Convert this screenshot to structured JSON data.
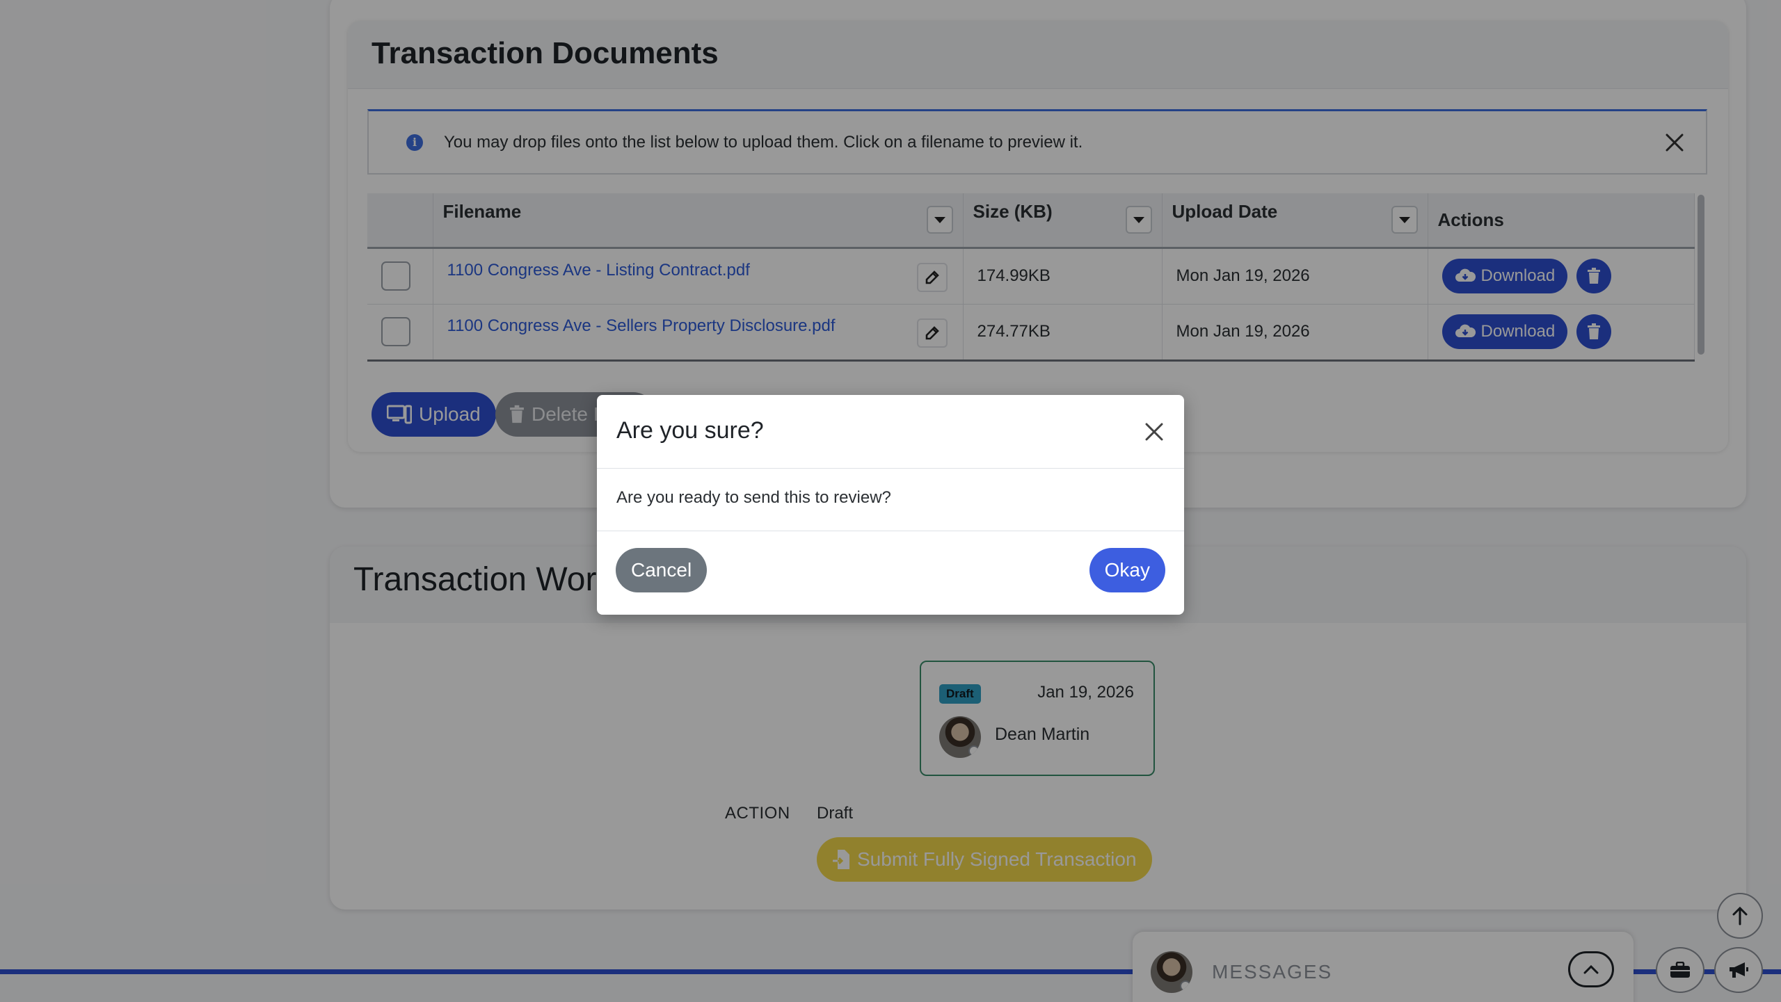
{
  "documents": {
    "title": "Transaction Documents",
    "info_text": "You may drop files onto the list below to upload them. Click on a filename to preview it.",
    "columns": {
      "filename": "Filename",
      "size": "Size (KB)",
      "upload_date": "Upload Date",
      "actions": "Actions"
    },
    "rows": [
      {
        "filename": "1100 Congress Ave - Listing Contract.pdf",
        "size": "174.99KB",
        "upload_date": "Mon Jan 19, 2026",
        "download_label": "Download"
      },
      {
        "filename": "1100 Congress Ave - Sellers Property Disclosure.pdf",
        "size": "274.77KB",
        "upload_date": "Mon Jan 19, 2026",
        "download_label": "Download"
      }
    ],
    "upload_label": "Upload",
    "delete_label": "Delete I"
  },
  "workflow": {
    "title": "Transaction Wor",
    "step": {
      "badge": "Draft",
      "date": "Jan 19, 2026",
      "user": "Dean Martin"
    },
    "action_label": "ACTION",
    "action_value": "Draft",
    "submit_label": "Submit Fully Signed Transaction"
  },
  "messages": {
    "label": "MESSAGES"
  },
  "modal": {
    "title": "Are you sure?",
    "body": "Are you ready to send this to review?",
    "cancel_label": "Cancel",
    "okay_label": "Okay"
  },
  "colors": {
    "primary": "#2e4fd0",
    "warning": "#f2d84b",
    "info": "#2f9fc4",
    "secondary": "#6c757d"
  }
}
